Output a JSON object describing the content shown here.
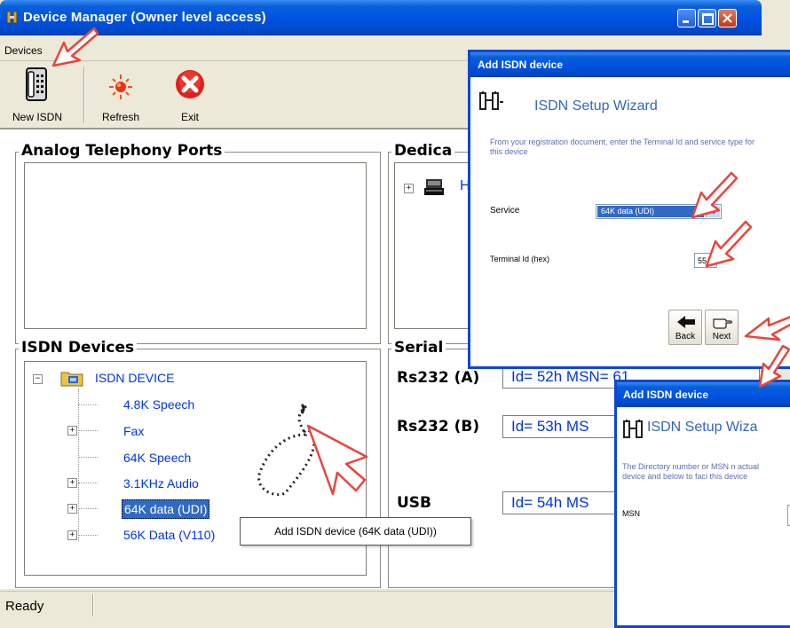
{
  "window": {
    "title": "Device Manager (Owner level access)"
  },
  "menu": {
    "devices": "Devices"
  },
  "toolbar": {
    "new_isdn": "New ISDN",
    "refresh": "Refresh",
    "exit": "Exit"
  },
  "groups": {
    "analog": "Analog Telephony Ports",
    "dedicated": "Dedica",
    "dedicated_item": "H",
    "isdn": "ISDN Devices",
    "serial": "Serial"
  },
  "isdn_tree": {
    "root": "ISDN DEVICE",
    "items": [
      "4.8K Speech",
      "Fax",
      "64K Speech",
      "3.1KHz Audio",
      "64K data (UDI)",
      "56K Data (V110)"
    ]
  },
  "serial": {
    "rows": [
      {
        "label": "Rs232 (A)",
        "value": "Id= 52h  MSN= 61"
      },
      {
        "label": "Rs232 (B)",
        "value": "Id= 53h  MS"
      },
      {
        "label": "USB",
        "value": "Id= 54h  MS"
      }
    ]
  },
  "tooltip": "Add ISDN device (64K data (UDI))",
  "status": {
    "text": "Ready"
  },
  "dialog1": {
    "title": "Add ISDN device",
    "heading": "ISDN Setup Wizard",
    "instruction": "From your registration document, enter the Terminal Id and service type for this device",
    "service_label": "Service",
    "service_value": "64K data (UDI)",
    "terminal_label": "Terminal Id (hex)",
    "terminal_value": "55",
    "back": "Back",
    "next": "Next"
  },
  "dialog2": {
    "title": "Add ISDN device",
    "heading": "ISDN Setup Wiza",
    "instruction": "The Directory number or MSN n actual device and below to faci this device",
    "msn_label": "MSN"
  },
  "colors": {
    "accent": "#0054e3",
    "link": "#0033ee",
    "annotation": "#e8463c",
    "selection": "#316ac5"
  }
}
